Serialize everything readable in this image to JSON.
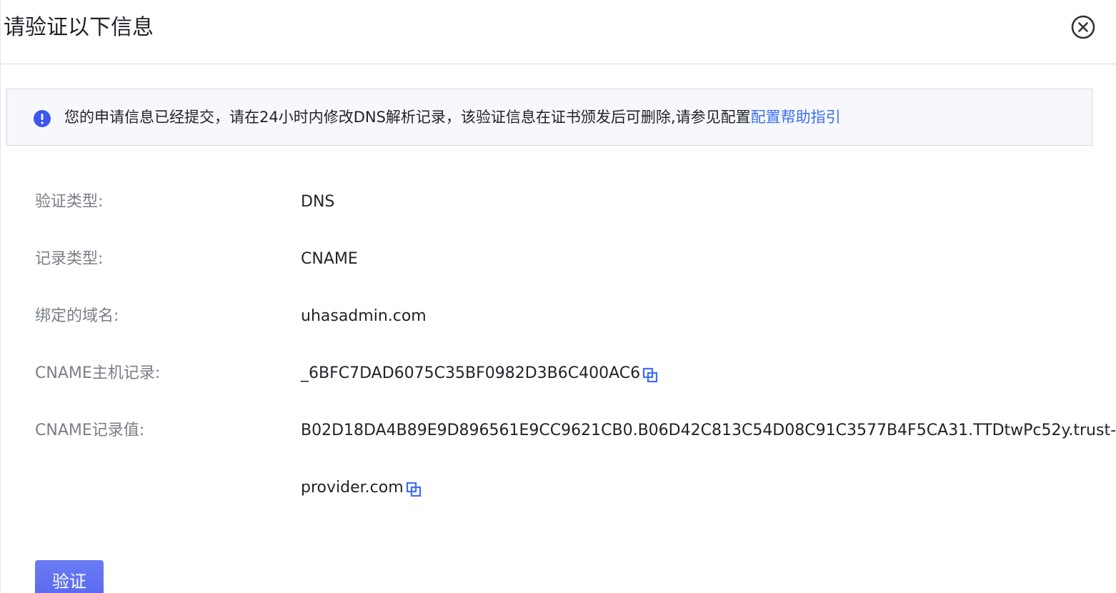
{
  "dialog": {
    "title": "请验证以下信息"
  },
  "notice": {
    "text": "您的申请信息已经提交，请在24小时内修改DNS解析记录，该验证信息在证书颁发后可删除,请参见配置",
    "link_text": "配置帮助指引"
  },
  "fields": {
    "verify_type": {
      "label": "验证类型:",
      "value": "DNS"
    },
    "record_type": {
      "label": "记录类型:",
      "value": "CNAME"
    },
    "domain": {
      "label": "绑定的域名:",
      "value": "uhasadmin.com"
    },
    "cname_host": {
      "label": "CNAME主机记录:",
      "value": "_6BFC7DAD6075C35BF0982D3B6C400AC6"
    },
    "cname_value": {
      "label": "CNAME记录值:",
      "value_line1": "B02D18DA4B89E9D896561E9CC9621CB0.B06D42C813C54D08C91C3577B4F5CA31.TTDtwPc52y.trust-",
      "value_line2": "provider.com"
    }
  },
  "actions": {
    "verify_label": "验证"
  },
  "icons": {
    "close": "close-circle-icon",
    "info": "info-circle-icon",
    "copy": "copy-icon"
  },
  "colors": {
    "accent": "#3d6ef5",
    "button": "#5b6ef0",
    "label": "#7a7e86",
    "notice_bg": "#f7f8fb"
  }
}
